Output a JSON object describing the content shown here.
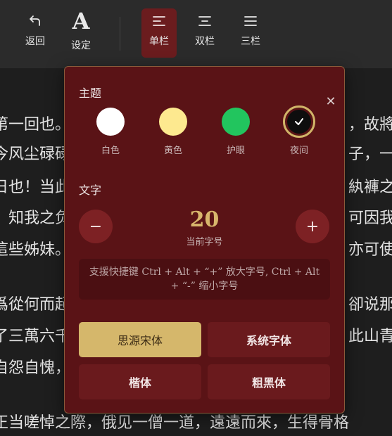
{
  "toolbar": {
    "back_label": "返回",
    "settings_label": "设定",
    "single_col_label": "单栏",
    "double_col_label": "双栏",
    "triple_col_label": "三栏",
    "active": "single"
  },
  "reader_lines": {
    "l1": "第一回也。",
    "l1r": "，故將",
    "l2": "今风尘碌碌",
    "l2r": "子，一",
    "l3": "日也！当此",
    "l3r": "紈褲之",
    "l4": "，知我之负",
    "l4r": "可因我",
    "l5": "這些姊妹。",
    "l5r": "亦可使",
    "l6": "爲從何而起",
    "l6r": "卻说那",
    "l7": "了三萬六千",
    "l7r": "此山青",
    "l8": "自怨自愧，",
    "l9": "正当嗟悼之際，俄见一僧一道，遠遠而來，生得骨格"
  },
  "panel": {
    "theme_title": "主题",
    "themes": [
      {
        "label": "白色",
        "color": "#ffffff",
        "icon": "none"
      },
      {
        "label": "黄色",
        "color": "#fde98f",
        "icon": "none"
      },
      {
        "label": "护眼",
        "color": "#22c55e",
        "icon": "none"
      },
      {
        "label": "夜间",
        "color": "#0e0e0e",
        "icon": "check-icon"
      }
    ],
    "selected_theme": "夜间",
    "text_title": "文字",
    "font_size": "20",
    "font_size_caption": "当前字号",
    "decrease_symbol": "−",
    "increase_symbol": "+",
    "close_symbol": "✕",
    "hint_line1": "支援快捷键 Ctrl + Alt + “+” 放大字号, Ctrl + Alt",
    "hint_line2": "+ “-” 缩小字号",
    "fonts": [
      {
        "label": "思源宋体",
        "selected": true
      },
      {
        "label": "系统字体",
        "selected": false
      },
      {
        "label": "楷体",
        "selected": false
      },
      {
        "label": "粗黑体",
        "selected": false
      }
    ]
  },
  "colors": {
    "panel_bg": "#5a1316",
    "accent_gold": "#d5b76b",
    "button_red": "#7d2124"
  }
}
